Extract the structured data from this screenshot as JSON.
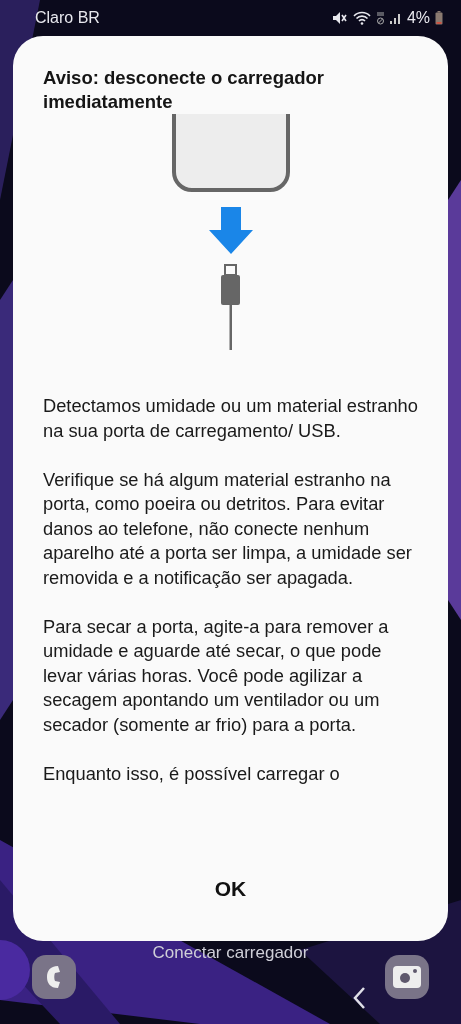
{
  "status_bar": {
    "carrier": "Claro BR",
    "battery": "4%"
  },
  "dialog": {
    "title": "Aviso: desconecte o carregador imediatamente",
    "paragraphs": [
      "Detectamos umidade ou um material estranho na sua porta de carregamento/ USB.",
      "Verifique se há algum material estranho na porta, como poeira ou detritos. Para evitar danos ao telefone, não conecte nenhum aparelho até a porta ser limpa, a umidade ser removida e a notificação ser apagada.",
      "Para secar a porta, agite-a para remover a umidade e aguarde até secar, o que pode levar várias horas. Você pode agilizar a secagem apontando um ventilador ou um secador (somente ar frio) para a porta.",
      "Enquanto isso, é possível carregar o"
    ],
    "button": "OK"
  },
  "lock_screen": {
    "hint": "Conectar carregador"
  }
}
